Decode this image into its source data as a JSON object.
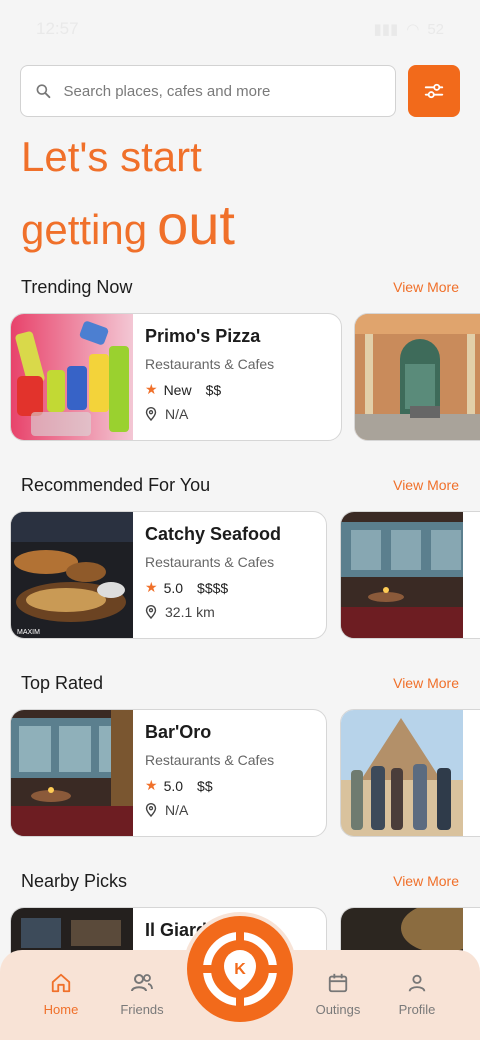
{
  "status_bar": {
    "time": "12:57",
    "signal": "▮▮▮",
    "wifi": "◠",
    "battery": "52"
  },
  "search": {
    "placeholder": "Search places, cafes and more"
  },
  "hero": {
    "line1": "Let's start",
    "line2_small": "getting",
    "line2_big": "out"
  },
  "sections": [
    {
      "title": "Trending Now",
      "view_more": "View More",
      "cards": [
        {
          "name": "Primo's Pizza",
          "category": "Restaurants & Cafes",
          "rating": "New",
          "price": "$$",
          "location": "N/A"
        }
      ]
    },
    {
      "title": "Recommended For You",
      "view_more": "View More",
      "cards": [
        {
          "name": "Catchy Seafood",
          "category": "Restaurants & Cafes",
          "rating": "5.0",
          "price": "$$$$",
          "location": "32.1 km"
        }
      ]
    },
    {
      "title": "Top Rated",
      "view_more": "View More",
      "cards": [
        {
          "name": "Bar'Oro",
          "category": "Restaurants & Cafes",
          "rating": "5.0",
          "price": "$$",
          "location": "N/A"
        }
      ]
    },
    {
      "title": "Nearby Picks",
      "view_more": "View More",
      "cards": [
        {
          "name": "Il Giardi"
        }
      ]
    }
  ],
  "bottom_nav": {
    "home": "Home",
    "friends": "Friends",
    "outings": "Outings",
    "profile": "Profile",
    "center_logo": "K"
  },
  "colors": {
    "accent": "#f26a1b",
    "nav_bg": "#f8e3d6"
  }
}
